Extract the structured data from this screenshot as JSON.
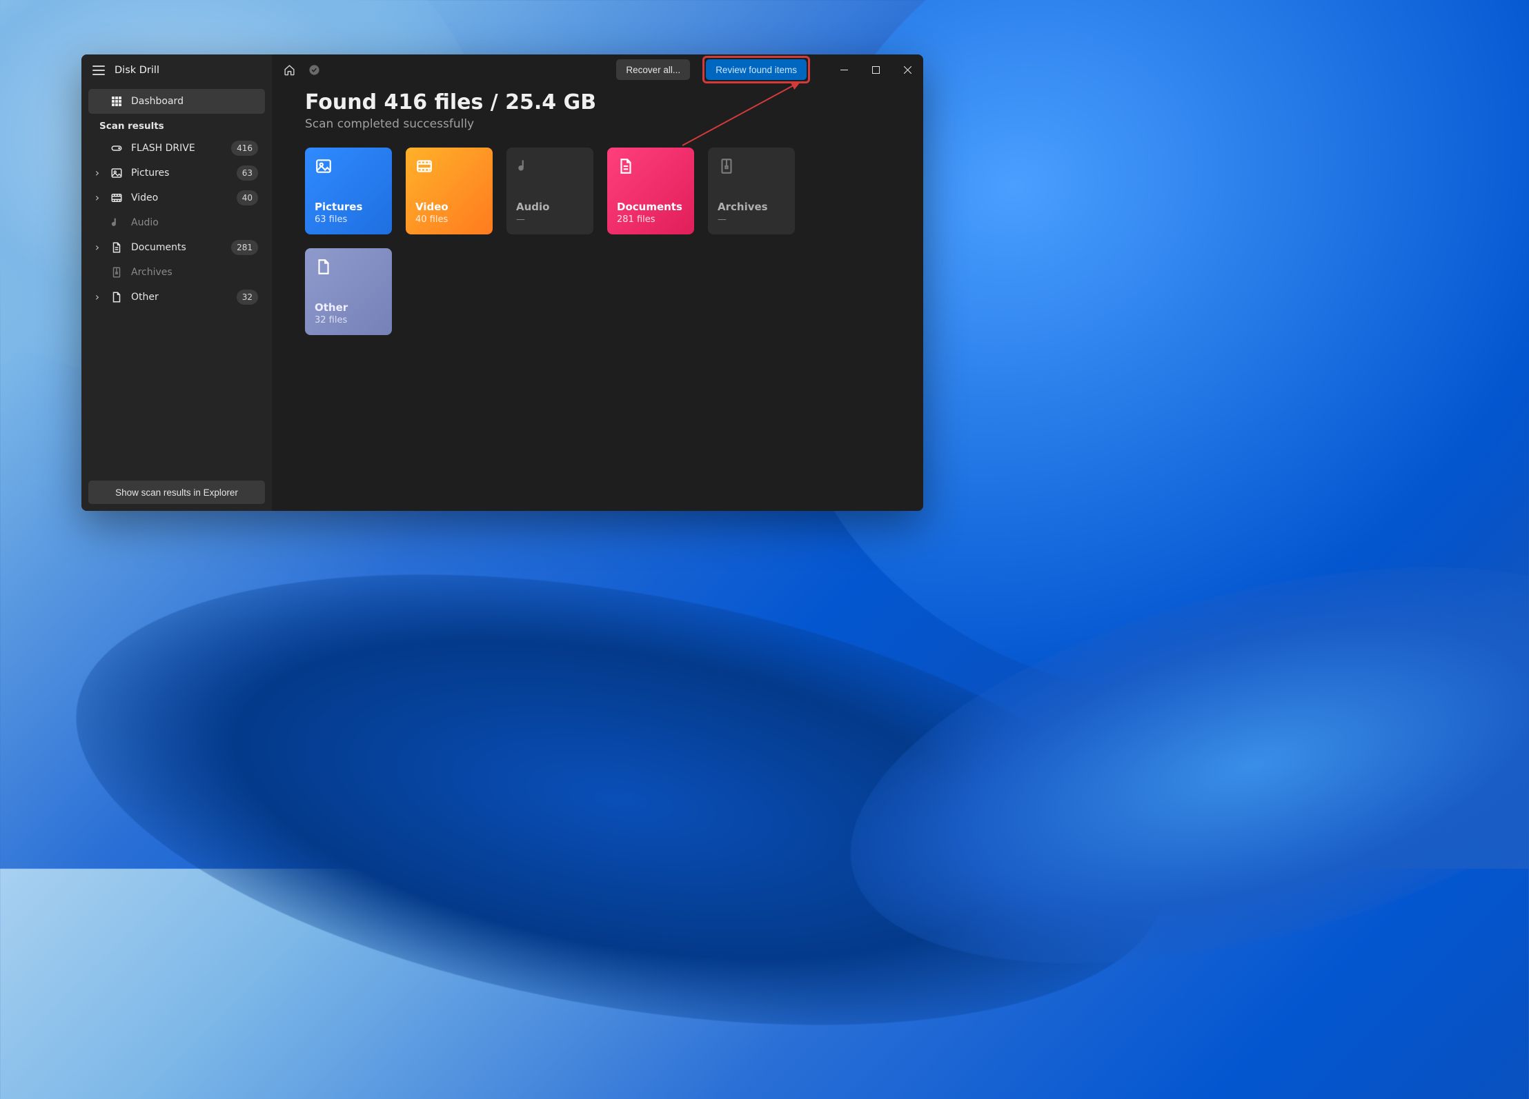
{
  "app": {
    "title": "Disk Drill"
  },
  "sidebar": {
    "dashboard_label": "Dashboard",
    "section_label": "Scan results",
    "items": [
      {
        "label": "FLASH DRIVE",
        "count": "416",
        "icon": "drive",
        "expandable": false,
        "dim": false,
        "indent": true
      },
      {
        "label": "Pictures",
        "count": "63",
        "icon": "pictures",
        "expandable": true,
        "dim": false,
        "indent": false
      },
      {
        "label": "Video",
        "count": "40",
        "icon": "video",
        "expandable": true,
        "dim": false,
        "indent": false
      },
      {
        "label": "Audio",
        "count": "",
        "icon": "audio",
        "expandable": false,
        "dim": true,
        "indent": true
      },
      {
        "label": "Documents",
        "count": "281",
        "icon": "documents",
        "expandable": true,
        "dim": false,
        "indent": false
      },
      {
        "label": "Archives",
        "count": "",
        "icon": "archives",
        "expandable": false,
        "dim": true,
        "indent": true
      },
      {
        "label": "Other",
        "count": "32",
        "icon": "other",
        "expandable": true,
        "dim": false,
        "indent": false
      }
    ],
    "explorer_btn": "Show scan results in Explorer"
  },
  "titlebar": {
    "recover_label": "Recover all...",
    "review_label": "Review found items"
  },
  "main": {
    "headline": "Found 416 files / 25.4 GB",
    "subhead": "Scan completed successfully",
    "cards": [
      {
        "title": "Pictures",
        "sub": "63 files",
        "style": "pictures",
        "icon": "pictures"
      },
      {
        "title": "Video",
        "sub": "40 files",
        "style": "video",
        "icon": "video"
      },
      {
        "title": "Audio",
        "sub": "—",
        "style": "dim",
        "icon": "audio"
      },
      {
        "title": "Documents",
        "sub": "281 files",
        "style": "documents",
        "icon": "documents"
      },
      {
        "title": "Archives",
        "sub": "—",
        "style": "dim",
        "icon": "archives"
      },
      {
        "title": "Other",
        "sub": "32 files",
        "style": "other",
        "icon": "other"
      }
    ]
  },
  "annotation": {
    "highlight_color": "#d43a3a"
  }
}
